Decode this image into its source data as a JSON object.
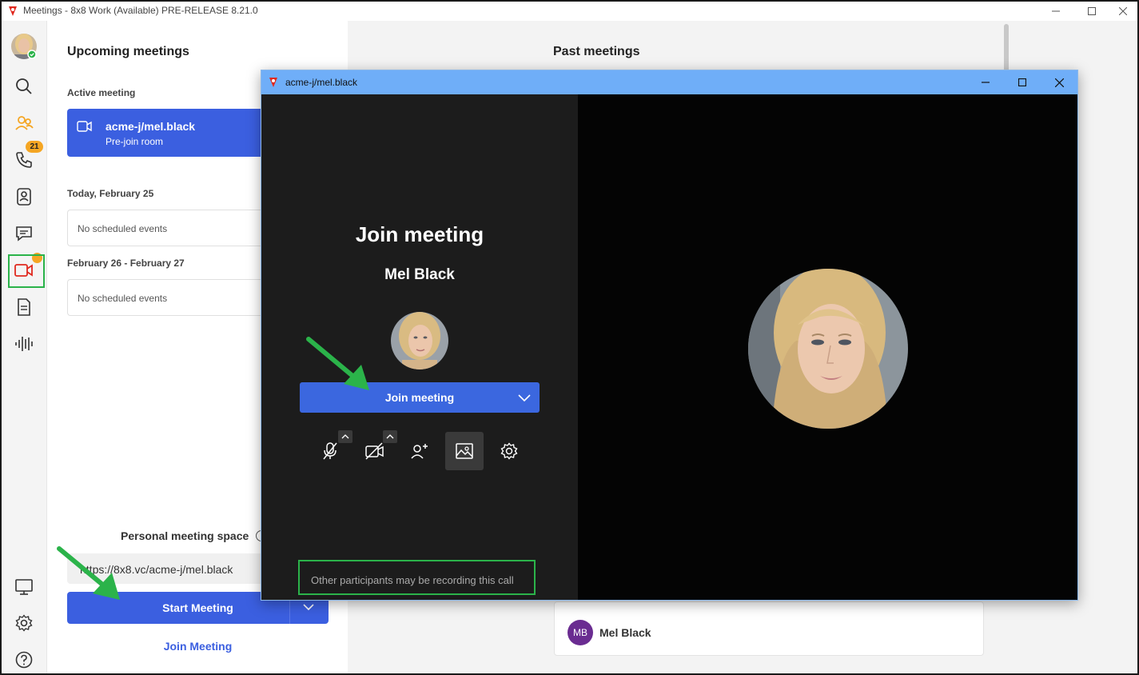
{
  "app": {
    "window_title": "Meetings - 8x8 Work (Available) PRE-RELEASE 8.21.0",
    "rail_badge_calls": "21"
  },
  "upcoming": {
    "heading": "Upcoming meetings",
    "active_label": "Active meeting",
    "active_title": "acme-j/mel.black",
    "active_subtitle": "Pre-join room",
    "today_label": "Today, February 25",
    "today_empty": "No scheduled events",
    "range_label": "February 26 - February 27",
    "range_empty": "No scheduled events",
    "personal_space_label": "Personal meeting space",
    "personal_url": "https://8x8.vc/acme-j/mel.black",
    "start_button": "Start Meeting",
    "join_link": "Join Meeting"
  },
  "past": {
    "heading": "Past meetings",
    "entries": [
      {
        "initials": "MB",
        "name": "Mel Black"
      }
    ]
  },
  "prejoin": {
    "window_title": "acme-j/mel.black",
    "heading": "Join meeting",
    "user_name": "Mel Black",
    "join_button": "Join meeting",
    "recording_note": "Other participants may be recording this call"
  },
  "colors": {
    "brand_blue": "#3b5fe0",
    "annotation_green": "#2bb34a",
    "badge_orange": "#f5a623",
    "prejoin_titlebar": "#6faef8"
  },
  "icons": [
    "search-icon",
    "people-icon",
    "phone-icon",
    "contacts-icon",
    "chat-icon",
    "video-icon",
    "document-icon",
    "voicemail-icon",
    "monitor-icon",
    "gear-icon",
    "help-icon",
    "mic-off-icon",
    "camera-off-icon",
    "add-person-icon",
    "background-icon",
    "settings-icon"
  ]
}
